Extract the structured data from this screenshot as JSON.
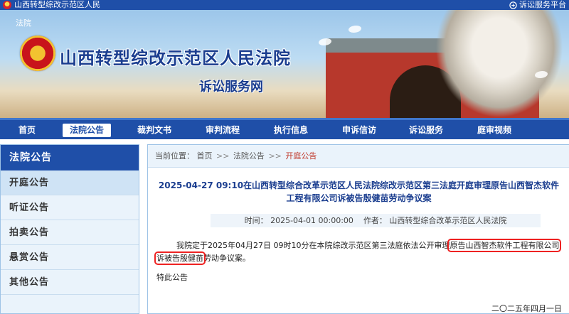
{
  "topbar": {
    "left_text": "山西转型综改示范区人民",
    "right_text": "诉讼服务平台"
  },
  "banner": {
    "site_tag": "法院",
    "title": "山西转型综改示范区人民法院",
    "subtitle": "诉讼服务网"
  },
  "nav": {
    "items": [
      "首页",
      "法院公告",
      "裁判文书",
      "审判流程",
      "执行信息",
      "申诉信访",
      "诉讼服务",
      "庭审视频"
    ],
    "active_index": 1
  },
  "sidebar": {
    "heading": "法院公告",
    "items": [
      "开庭公告",
      "听证公告",
      "拍卖公告",
      "悬赏公告",
      "其他公告"
    ],
    "active_index": 0
  },
  "breadcrumb": {
    "label": "当前位置：",
    "home": "首页",
    "sep": ">>",
    "section": "法院公告",
    "current": "开庭公告"
  },
  "article": {
    "title_line1": "2025-04-27 09:10在山西转型综合改革示范区人民法院综改示范区第三法庭开庭审理原告山西智杰软件",
    "title_line2": "工程有限公司诉被告殷健苗劳动争议案",
    "time_label": "时间：",
    "time_value": "2025-04-01 00:00:00",
    "author_label": "作者：",
    "author_value": "山西转型综合改革示范区人民法院",
    "body_part1": "我院定于2025年04月27日 09时10分在本院综改示范区第三法庭依法公开审理",
    "body_hl1": "原告山西智杰软件工程有限公司",
    "body_hl2": "诉被告殷健苗",
    "body_part2": "劳动争议案。",
    "notice": "特此公告",
    "date": "二〇二五年四月一日"
  },
  "colors": {
    "brand_blue": "#1f4fa8",
    "highlight_red": "#e22222",
    "current_crumb": "#c0392b"
  }
}
